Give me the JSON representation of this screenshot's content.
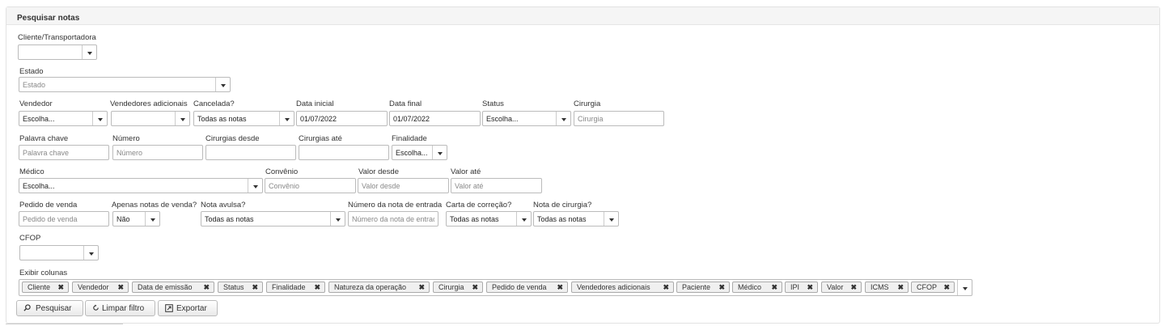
{
  "panel": {
    "title": "Pesquisar notas"
  },
  "fields": {
    "cliente": {
      "label": "Cliente/Transportadora",
      "value": ""
    },
    "estado": {
      "label": "Estado",
      "placeholder": "Estado"
    },
    "vendedor": {
      "label": "Vendedor",
      "value": "Escolha..."
    },
    "vendedores_adicionais": {
      "label": "Vendedores adicionais",
      "value": ""
    },
    "cancelada": {
      "label": "Cancelada?",
      "value": "Todas as notas"
    },
    "data_inicial": {
      "label": "Data inicial",
      "value": "01/07/2022"
    },
    "data_final": {
      "label": "Data final",
      "value": "01/07/2022"
    },
    "status": {
      "label": "Status",
      "value": "Escolha..."
    },
    "cirurgia": {
      "label": "Cirurgia",
      "placeholder": "Cirurgia"
    },
    "palavra_chave": {
      "label": "Palavra chave",
      "placeholder": "Palavra chave"
    },
    "numero": {
      "label": "Número",
      "placeholder": "Número"
    },
    "cirurgias_desde": {
      "label": "Cirurgias desde",
      "value": ""
    },
    "cirurgias_ate": {
      "label": "Cirurgias até",
      "value": ""
    },
    "finalidade": {
      "label": "Finalidade",
      "value": "Escolha..."
    },
    "medico": {
      "label": "Médico",
      "value": "Escolha..."
    },
    "convenio": {
      "label": "Convênio",
      "placeholder": "Convênio"
    },
    "valor_desde": {
      "label": "Valor desde",
      "placeholder": "Valor desde"
    },
    "valor_ate": {
      "label": "Valor até",
      "placeholder": "Valor até"
    },
    "pedido_venda": {
      "label": "Pedido de venda",
      "placeholder": "Pedido de venda"
    },
    "apenas_notas_venda": {
      "label": "Apenas notas de venda?",
      "value": "Não"
    },
    "nota_avulsa": {
      "label": "Nota avulsa?",
      "value": "Todas as notas"
    },
    "numero_nota_entrada": {
      "label": "Número da nota de entrada",
      "placeholder": "Número da nota de entrada"
    },
    "carta_correcao": {
      "label": "Carta de correção?",
      "value": "Todas as notas"
    },
    "nota_cirurgia": {
      "label": "Nota de cirurgia?",
      "value": "Todas as notas"
    },
    "cfop": {
      "label": "CFOP",
      "value": ""
    },
    "exibir_colunas": {
      "label": "Exibir colunas",
      "tags": [
        "Cliente",
        "Vendedor",
        "Data de emissão",
        "Status",
        "Finalidade",
        "Natureza da operação",
        "Cirurgia",
        "Pedido de venda",
        "Vendedores adicionais",
        "Paciente",
        "Médico",
        "IPI",
        "Valor",
        "ICMS",
        "CFOP"
      ],
      "remove_glyph": "✖"
    }
  },
  "actions": {
    "pesquisar": {
      "label": "Pesquisar",
      "icon": "search-icon"
    },
    "limpar": {
      "label": "Limpar filtro",
      "icon": "reset-icon"
    },
    "exportar": {
      "label": "Exportar",
      "icon": "export-icon"
    }
  }
}
